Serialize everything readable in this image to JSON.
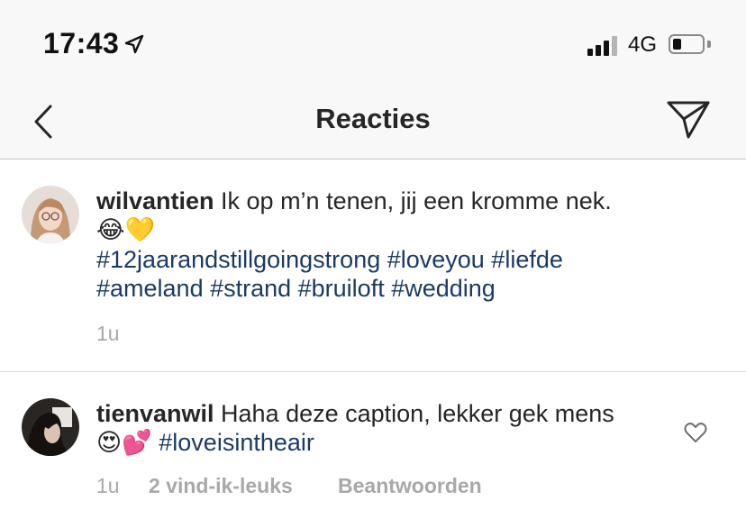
{
  "status_bar": {
    "time": "17:43",
    "network": "4G",
    "battery_fraction": 0.3
  },
  "nav": {
    "title": "Reacties",
    "back_icon": "chevron-left-icon",
    "send_icon": "paper-plane-icon"
  },
  "caption": {
    "username": "wilvantien",
    "text": " Ik op m’n tenen, jij een kromme nek.",
    "emojis": "😂💛",
    "hashtags_line1": "#12jaarandstillgoingstrong #loveyou #liefde",
    "hashtags_line2": "#ameland #strand #bruiloft #wedding",
    "time": "1u"
  },
  "comments": [
    {
      "username": "tienvanwil",
      "text": " Haha deze caption, lekker gek mens",
      "emojis": "😍💕",
      "hashtag": "#loveisintheair",
      "time": "1u",
      "likes": "2 vind-ik-leuks",
      "reply": "Beantwoorden"
    }
  ],
  "colors": {
    "hashtag": "#1b3a66",
    "meta": "#a8a8a8",
    "text": "#262626"
  }
}
